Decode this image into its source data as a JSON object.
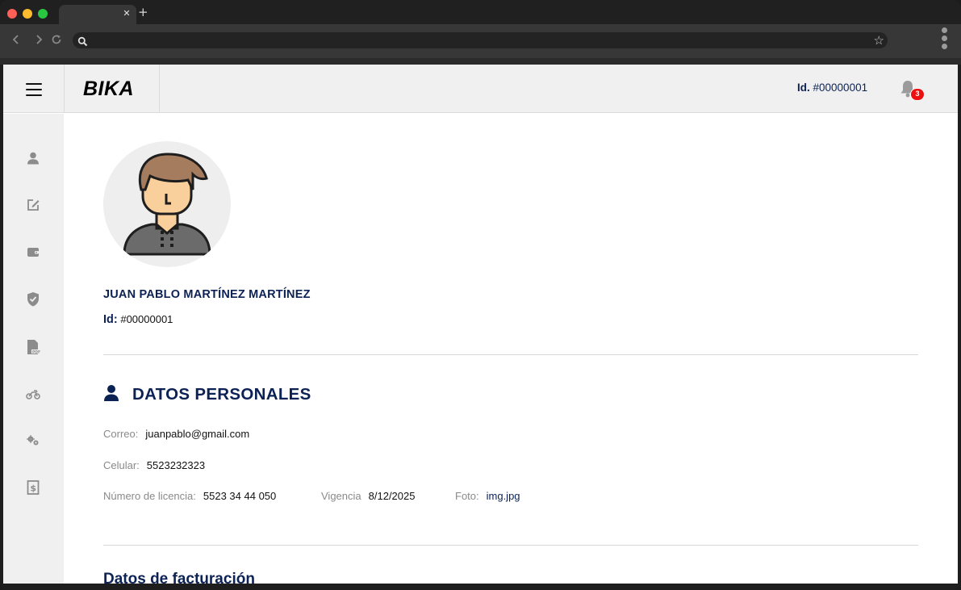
{
  "app": {
    "logo": "BIKA",
    "header_id_label": "Id.",
    "header_id_value": "#00000001",
    "notification_count": "3"
  },
  "profile": {
    "name": "JUAN PABLO MARTÍNEZ MARTÍNEZ",
    "id_label": "Id:",
    "id_value": "#00000001"
  },
  "personal": {
    "title": "DATOS PERSONALES",
    "correo_label": "Correo:",
    "correo_value": "juanpablo@gmail.com",
    "celular_label": "Celular:",
    "celular_value": "5523232323",
    "licencia_label": "Número de licencia:",
    "licencia_value": "5523 34 44 050",
    "vigencia_label": "Vigencia",
    "vigencia_value": "8/12/2025",
    "foto_label": "Foto:",
    "foto_value": "img.jpg"
  },
  "billing": {
    "title": "Datos de facturación"
  },
  "sidebar": {
    "icons": [
      "user-icon",
      "edit-icon",
      "wallet-icon",
      "shield-icon",
      "pdf-icon",
      "motorcycle-icon",
      "gears-icon",
      "money-icon"
    ]
  },
  "colors": {
    "accent": "#0c2254",
    "badge": "#ee1010",
    "sidebar_bg": "#f0f0f0"
  }
}
